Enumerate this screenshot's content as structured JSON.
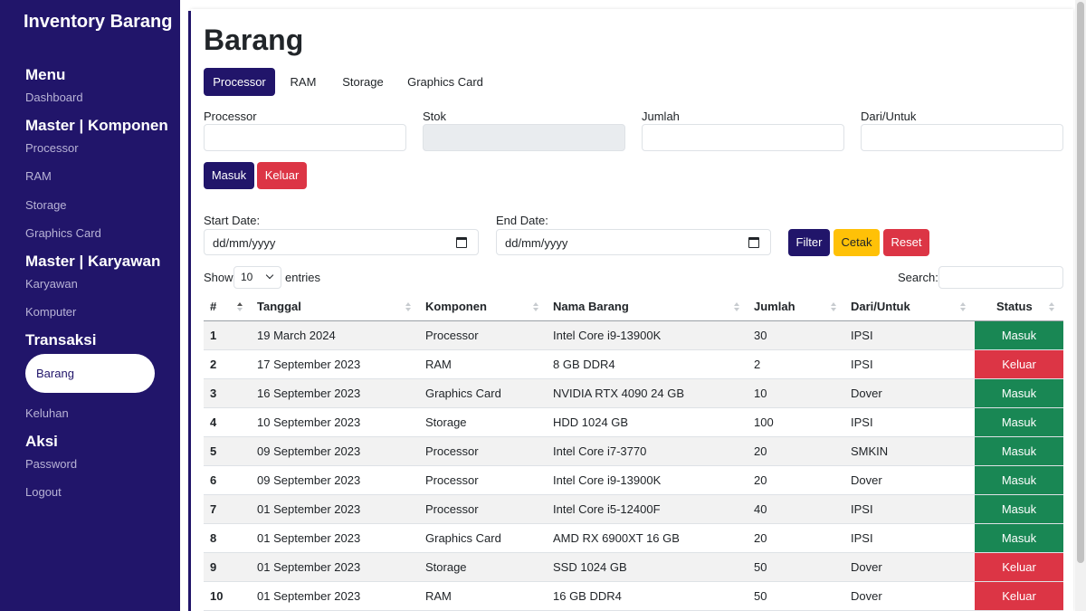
{
  "sidebar": {
    "brand": "Inventory Barang",
    "menu_head": "Menu",
    "dashboard": "Dashboard",
    "master_komponen_head": "Master | Komponen",
    "processor": "Processor",
    "ram": "RAM",
    "storage": "Storage",
    "graphics_card": "Graphics Card",
    "master_karyawan_head": "Master | Karyawan",
    "karyawan": "Karyawan",
    "komputer": "Komputer",
    "transaksi_head": "Transaksi",
    "barang": "Barang",
    "keluhan": "Keluhan",
    "aksi_head": "Aksi",
    "password": "Password",
    "logout": "Logout"
  },
  "page": {
    "title": "Barang",
    "tabs": [
      "Processor",
      "RAM",
      "Storage",
      "Graphics Card"
    ],
    "active_tab": "Processor"
  },
  "form": {
    "processor_label": "Processor",
    "stok_label": "Stok",
    "jumlah_label": "Jumlah",
    "dari_untuk_label": "Dari/Untuk",
    "masuk_button": "Masuk",
    "keluar_button": "Keluar"
  },
  "filter": {
    "start_date_label": "Start Date:",
    "end_date_label": "End Date:",
    "start_date_value": "dd/mm/yyyy",
    "end_date_value": "dd/mm/yyyy",
    "filter_button": "Filter",
    "cetak_button": "Cetak",
    "reset_button": "Reset"
  },
  "datatable": {
    "show_label": "Show",
    "entries_value": "10",
    "entries_label": "entries",
    "search_label": "Search:"
  },
  "table": {
    "headers": [
      "#",
      "Tanggal",
      "Komponen",
      "Nama Barang",
      "Jumlah",
      "Dari/Untuk",
      "Status"
    ],
    "rows": [
      [
        "1",
        "19 March 2024",
        "Processor",
        "Intel Core i9-13900K",
        "30",
        "IPSI",
        "Masuk"
      ],
      [
        "2",
        "17 September 2023",
        "RAM",
        "8 GB DDR4",
        "2",
        "IPSI",
        "Keluar"
      ],
      [
        "3",
        "16 September 2023",
        "Graphics Card",
        "NVIDIA RTX 4090 24 GB",
        "10",
        "Dover",
        "Masuk"
      ],
      [
        "4",
        "10 September 2023",
        "Storage",
        "HDD 1024 GB",
        "100",
        "IPSI",
        "Masuk"
      ],
      [
        "5",
        "09 September 2023",
        "Processor",
        "Intel Core i7-3770",
        "20",
        "SMKIN",
        "Masuk"
      ],
      [
        "6",
        "09 September 2023",
        "Processor",
        "Intel Core i9-13900K",
        "20",
        "Dover",
        "Masuk"
      ],
      [
        "7",
        "01 September 2023",
        "Processor",
        "Intel Core i5-12400F",
        "40",
        "IPSI",
        "Masuk"
      ],
      [
        "8",
        "01 September 2023",
        "Graphics Card",
        "AMD RX 6900XT 16 GB",
        "20",
        "IPSI",
        "Masuk"
      ],
      [
        "9",
        "01 September 2023",
        "Storage",
        "SSD 1024 GB",
        "50",
        "Dover",
        "Keluar"
      ],
      [
        "10",
        "01 September 2023",
        "RAM",
        "16 GB DDR4",
        "50",
        "Dover",
        "Keluar"
      ]
    ]
  },
  "colors": {
    "primary": "#21156a",
    "success": "#198754",
    "danger": "#dc3545",
    "warning": "#ffc107"
  }
}
